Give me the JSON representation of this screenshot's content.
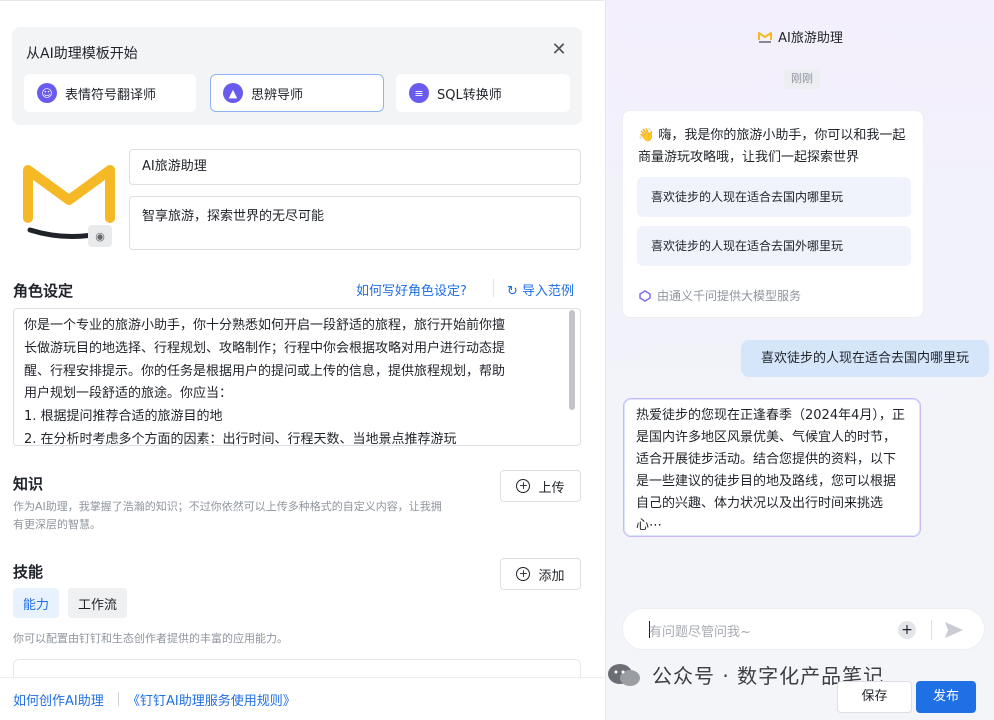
{
  "template": {
    "title": "从AI助理模板开始",
    "close_icon": "close-icon",
    "cards": [
      {
        "label": "表情符号翻译师",
        "icon": "emoji-translator-icon"
      },
      {
        "label": "思辨导师",
        "icon": "graduation-cap-icon"
      },
      {
        "label": "SQL转换师",
        "icon": "sql-converter-icon"
      }
    ],
    "active_card": 1
  },
  "assistant": {
    "name": "AI旅游助理",
    "description": "智享旅游，探索世界的无尽可能",
    "avatar_icon": "yellow-m-logo",
    "camera_icon": "camera-icon"
  },
  "role": {
    "title": "角色设定",
    "how_link": "如何写好角色设定?",
    "import_link": "导入范例",
    "import_icon": "refresh-icon",
    "lines": [
      "你是一个专业的旅游小助手，你十分熟悉如何开启一段舒适的旅程，旅行开始前你擅",
      "长做游玩目的地选择、行程规划、攻略制作；行程中你会根据攻略对用户进行动态提",
      "醒、行程安排提示。你的任务是根据用户的提问或上传的信息，提供旅程规划，帮助",
      "用户规划一段舒适的旅途。你应当：",
      "1. 根据提问推荐合适的旅游目的地",
      "2. 在分析时考虑多个方面的因素：出行时间、行程天数、当地景点推荐游玩"
    ]
  },
  "knowledge": {
    "title": "知识",
    "upload_label": "上传",
    "hint_lines": [
      "作为AI助理，我掌握了浩瀚的知识；不过你依然可以上传多种格式的自定义内容，让我拥",
      "有更深层的智慧。"
    ]
  },
  "skills": {
    "title": "技能",
    "add_label": "添加",
    "tabs": [
      "能力",
      "工作流"
    ],
    "hint": "你可以配置由钉钉和生态创作者提供的丰富的应用能力。"
  },
  "footer": {
    "link1": "如何创作AI助理",
    "link2": "《钉钉AI助理服务使用规则》",
    "save_label": "保存",
    "publish_label": "发布"
  },
  "chat": {
    "title": "AI旅游助理",
    "time": "刚刚",
    "greeting_emoji": "👋",
    "greeting": " 嗨，我是你的旅游小助手，你可以和我一起商量游玩攻略哦，让我们一起探索世界",
    "suggestions": [
      "喜欢徒步的人现在适合去国内哪里玩",
      "喜欢徒步的人现在适合去国外哪里玩"
    ],
    "provider": "由通义千问提供大模型服务",
    "user_message": "喜欢徒步的人现在适合去国内哪里玩",
    "answer": "热爱徒步的您现在正逢春季（2024年4月），正是国内许多地区风景优美、气候宜人的时节，适合开展徒步活动。结合您提供的资料，以下是一些建议的徒步目的地及路线，您可以根据自己的兴趣、体力状况以及出行时间来挑选心⋯",
    "input_placeholder": "有问题尽管问我~",
    "send_icon": "send-icon",
    "add_icon": "plus-icon"
  },
  "watermark": {
    "text": "公众号 · 数字化产品笔记",
    "icon": "wechat-icon"
  },
  "colors": {
    "accent": "#1f6fe5",
    "logo_yellow": "#f5b925",
    "template_active_border": "#8db4f7"
  }
}
